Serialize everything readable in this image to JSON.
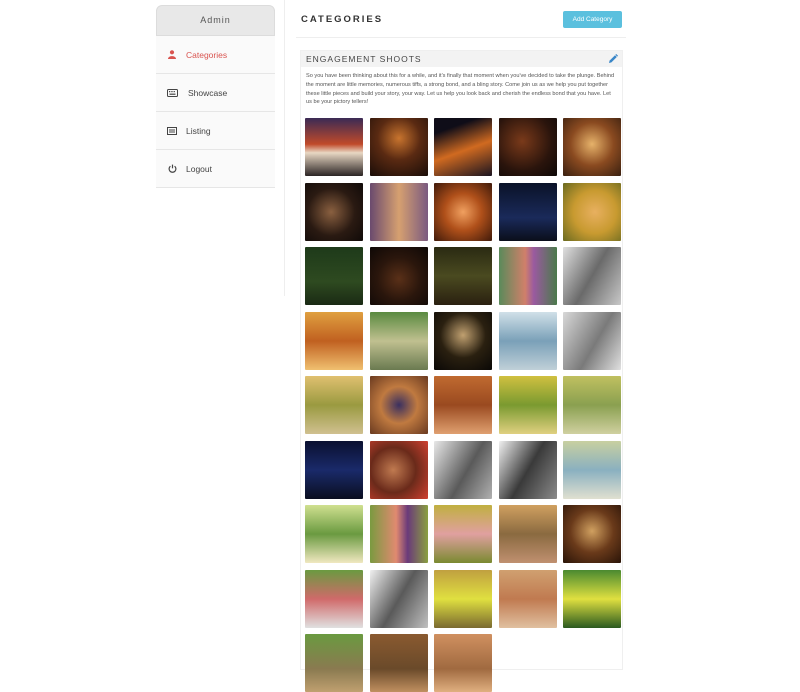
{
  "sidebar": {
    "header": "Admin",
    "items": [
      {
        "label": "Categories",
        "icon": "user-icon",
        "active": true
      },
      {
        "label": "Showcase",
        "icon": "keyboard-icon",
        "active": false
      },
      {
        "label": "Listing",
        "icon": "list-icon",
        "active": false
      },
      {
        "label": "Logout",
        "icon": "power-icon",
        "active": false
      }
    ]
  },
  "main": {
    "title": "CATEGORIES",
    "add_button": "Add Category"
  },
  "panel": {
    "title": "ENGAGEMENT SHOOTS",
    "description": "So you have been thinking about this for a while, and it's finally that moment when you've decided to take the plunge. Behind the moment are little memories, numerous tiffs, a strong bond, and a bling story. Come join us as we help you put together these little pieces and build your story, your way. Let us help you look back and cherish the endless bond that you have. Let us be your pictory tellers!"
  },
  "colors": {
    "accent_button": "#5bc0de",
    "active_item": "#d9534f"
  }
}
